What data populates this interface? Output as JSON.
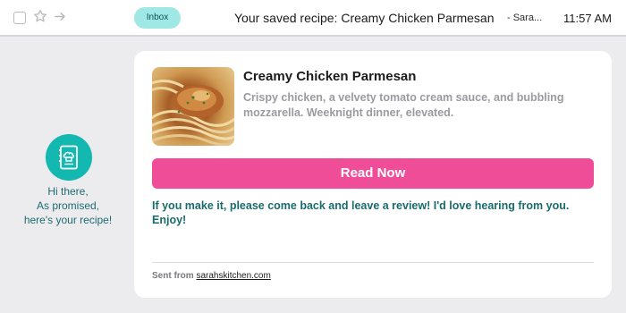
{
  "toolbar": {
    "inbox_label": "Inbox",
    "subject": "Your saved recipe: Creamy Chicken Parmesan",
    "sender": "- Sara...",
    "time": "11:57 AM",
    "icons": [
      "checkbox",
      "star-icon",
      "forward-arrow-icon"
    ]
  },
  "sidebar": {
    "avatar_icon": "recipe-book-icon",
    "greeting_line1": "Hi there,",
    "greeting_line2": "As promised,",
    "greeting_line3": "here's your recipe!"
  },
  "card": {
    "title": "Creamy Chicken Parmesan",
    "description": "Crispy chicken, a velvety tomato cream sauce, and bubbling mozzarella. Weeknight dinner, elevated.",
    "button_label": "Read Now",
    "cta_text": "If you make it, please come back and leave a review! I'd love hearing from you. Enjoy!",
    "footer_label": "Sent from",
    "footer_link": "sarahskitchen.com"
  },
  "colors": {
    "accent_pink": "#ef4d98",
    "teal": "#13b8b0",
    "badge": "#9fe8e6"
  }
}
